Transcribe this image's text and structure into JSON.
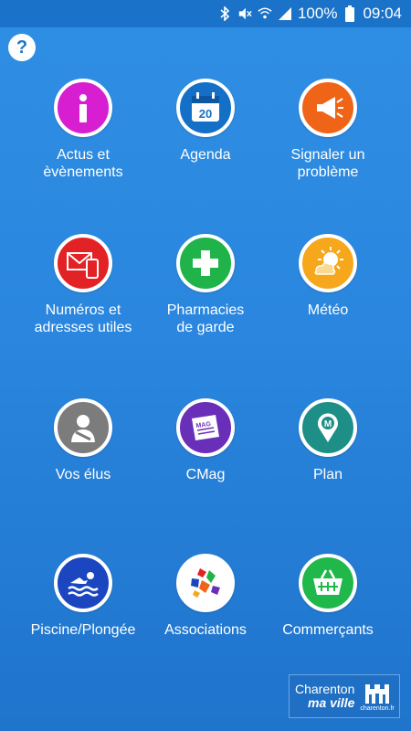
{
  "status_bar": {
    "battery_percent": "100%",
    "time": "09:04"
  },
  "help": {
    "label": "?"
  },
  "tiles": [
    {
      "label": "Actus et\nèvènements",
      "color": "#d81ed1",
      "icon": "info-icon"
    },
    {
      "label": "Agenda",
      "color": "#1470c7",
      "icon": "calendar-icon",
      "icon_text": "20"
    },
    {
      "label": "Signaler un\nproblème",
      "color": "#f06418",
      "icon": "megaphone-icon"
    },
    {
      "label": "Numéros et\nadresses utiles",
      "color": "#e32226",
      "icon": "mail-phone-icon"
    },
    {
      "label": "Pharmacies\nde garde",
      "color": "#1fb34a",
      "icon": "pharmacy-cross-icon"
    },
    {
      "label": "Météo",
      "color": "#f6a71c",
      "icon": "weather-icon"
    },
    {
      "label": "Vos élus",
      "color": "#7c7c7c",
      "icon": "person-icon"
    },
    {
      "label": "CMag",
      "color": "#6a2fb8",
      "icon": "magazine-icon",
      "icon_text": "MAG"
    },
    {
      "label": "Plan",
      "color": "#1d8f86",
      "icon": "map-pin-icon",
      "icon_text": "M"
    },
    {
      "label": "Piscine/Plongée",
      "color": "#1b46c0",
      "icon": "swimmer-icon"
    },
    {
      "label": "Associations",
      "color": "#ffffff",
      "icon": "associations-icon"
    },
    {
      "label": "Commerçants",
      "color": "#20b84a",
      "icon": "basket-icon"
    }
  ],
  "logo": {
    "line1": "Charenton",
    "line2": "ma ville",
    "domain": "charenton.fr"
  }
}
